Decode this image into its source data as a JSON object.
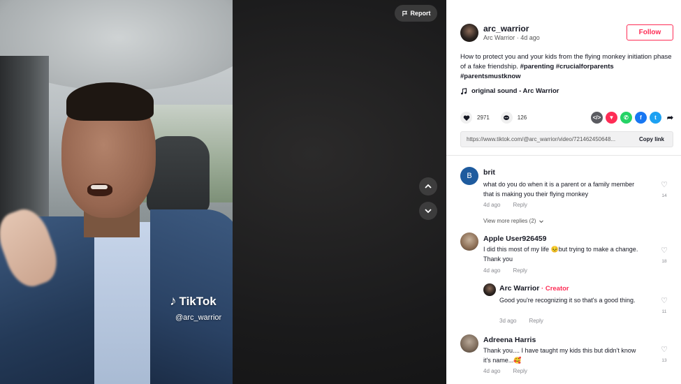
{
  "video": {
    "watermark_brand": "TikTok",
    "watermark_handle": "@arc_warrior",
    "report_label": "Report"
  },
  "author": {
    "handle": "arc_warrior",
    "display_name": "Arc Warrior",
    "time": "4d ago",
    "follow_label": "Follow"
  },
  "caption": {
    "text": "How to protect you and your kids from the flying monkey initiation phase of a fake friendship. ",
    "tags": [
      "#parenting",
      "#crucialforparents",
      "#parentsmustknow"
    ]
  },
  "sound": {
    "label": "original sound - Arc Warrior"
  },
  "stats": {
    "likes": "2971",
    "comments": "126"
  },
  "share_icons": [
    "embed-icon",
    "reddit-icon",
    "whatsapp-icon",
    "facebook-icon",
    "twitter-icon",
    "share-arrow-icon"
  ],
  "link": {
    "url": "https://www.tiktok.com/@arc_warrior/video/721462450648...",
    "copy_label": "Copy link"
  },
  "comments": [
    {
      "avatar_letter": "B",
      "user": "brit",
      "text": "what do you do when it is a parent or a family member that is making you their flying monkey",
      "time": "4d ago",
      "reply_label": "Reply",
      "likes": "14",
      "view_replies": "View more replies (2)"
    },
    {
      "user": "Apple User926459",
      "text_before": "I did this most of my life ",
      "emoji": "😣",
      "text_after": "but trying to make a change. Thank you",
      "time": "4d ago",
      "reply_label": "Reply",
      "likes": "18"
    },
    {
      "user": "Arc Warrior",
      "badge": " · Creator",
      "text": "Good you're recognizing it so that's a good thing.",
      "time": "3d ago",
      "reply_label": "Reply",
      "likes": "11"
    },
    {
      "user": "Adreena Harris",
      "text": "Thank you.... I have taught my kids this but didn't know it's name...",
      "emoji": "🥰",
      "time": "4d ago",
      "reply_label": "Reply",
      "likes": "13"
    }
  ],
  "colors": {
    "accent": "#fe2c55",
    "brit_avatar": "#1e5b9e"
  }
}
